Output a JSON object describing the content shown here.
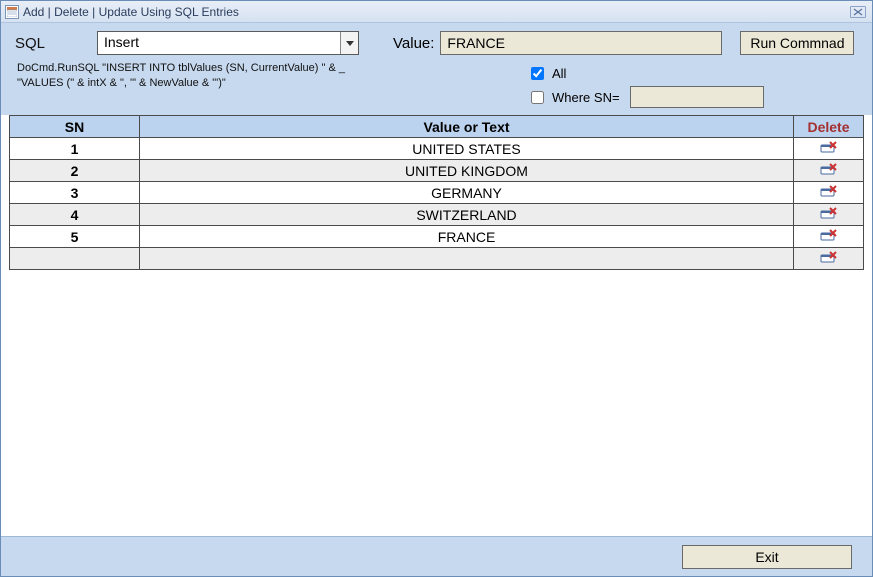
{
  "window": {
    "title": "Add | Delete | Update Using SQL Entries"
  },
  "form": {
    "sql_label": "SQL",
    "sql_dropdown_value": "Insert",
    "value_label": "Value:",
    "value_input": "FRANCE",
    "run_button": "Run Commnad",
    "sql_preview_line1": "DoCmd.RunSQL \"INSERT INTO tblValues (SN, CurrentValue) \" & _",
    "sql_preview_line2": "\"VALUES (\" & intX & \", '\" & NewValue & \"')\"",
    "opt_all_label": "All",
    "opt_all_checked": true,
    "opt_where_label": "Where SN=",
    "opt_where_checked": false,
    "opt_where_value": ""
  },
  "table": {
    "headers": {
      "sn": "SN",
      "value": "Value or Text",
      "delete": "Delete"
    },
    "rows": [
      {
        "sn": "1",
        "value": "UNITED STATES"
      },
      {
        "sn": "2",
        "value": "UNITED KINGDOM"
      },
      {
        "sn": "3",
        "value": "GERMANY"
      },
      {
        "sn": "4",
        "value": "SWITZERLAND"
      },
      {
        "sn": "5",
        "value": "FRANCE"
      }
    ]
  },
  "footer": {
    "exit_button": "Exit"
  }
}
